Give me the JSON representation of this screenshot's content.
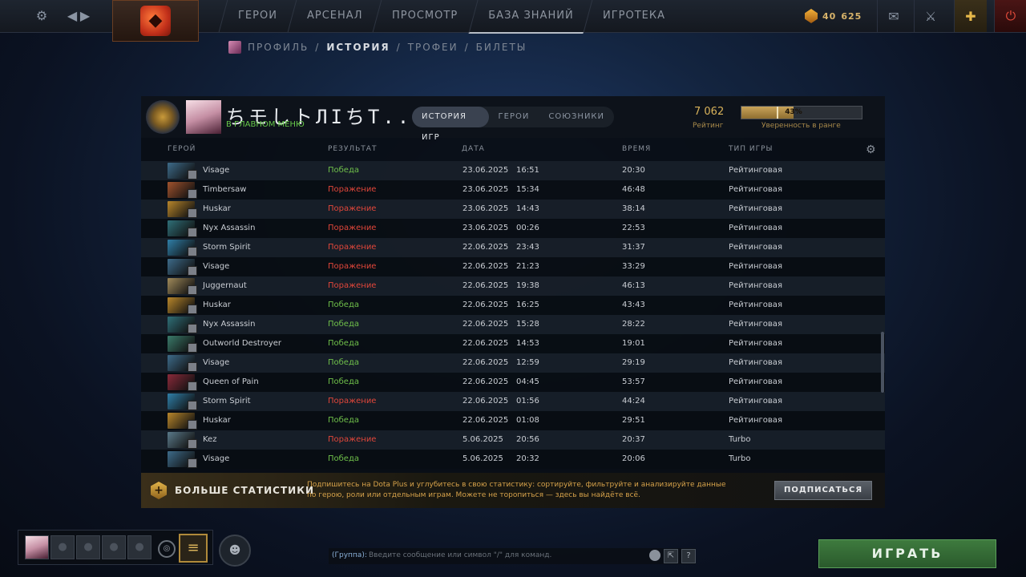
{
  "topbar": {
    "nav": [
      "ГЕРОИ",
      "АРСЕНАЛ",
      "ПРОСМОТР",
      "БАЗА ЗНАНИЙ",
      "ИГРОТЕКА"
    ],
    "currency_a": "40",
    "currency_b": "625",
    "icons": [
      "gear-icon",
      "back-arrow-icon",
      "forward-arrow-icon",
      "dota-logo-icon",
      "mail-icon",
      "armory-icon",
      "dota-plus-icon",
      "power-icon"
    ]
  },
  "subnav": {
    "profile": "ПРОФИЛЬ",
    "sep1": "/",
    "history": "ИСТОРИЯ",
    "sep2": "/",
    "trophies": "ТРОФЕИ",
    "sep3": "/",
    "tickets": "БИЛЕТЫ"
  },
  "player": {
    "name": "ちモしトЛIちT...",
    "status": "В ГЛАВНОМ МЕНЮ"
  },
  "tabs": [
    "ИСТОРИЯ ИГР",
    "ГЕРОИ",
    "СОЮЗНИКИ"
  ],
  "stats": {
    "rating_value": "7 062",
    "rating_label": "Рейтинг",
    "confidence_percent": 43,
    "confidence_text": "43%",
    "confidence_label": "Уверенность в ранге"
  },
  "table": {
    "headers": [
      "ГЕРОЙ",
      "РЕЗУЛЬТАТ",
      "ДАТА",
      "ВРЕМЯ",
      "ТИП ИГРЫ"
    ],
    "rows": [
      {
        "hero": "Visage",
        "result": "Победа",
        "win": true,
        "date": "23.06.2025",
        "time": "16:51",
        "duration": "20:30",
        "type": "Рейтинговая",
        "hero_color": "#3d6b8a"
      },
      {
        "hero": "Timbersaw",
        "result": "Поражение",
        "win": false,
        "date": "23.06.2025",
        "time": "15:34",
        "duration": "46:48",
        "type": "Рейтинговая",
        "hero_color": "#a0522d"
      },
      {
        "hero": "Huskar",
        "result": "Поражение",
        "win": false,
        "date": "23.06.2025",
        "time": "14:43",
        "duration": "38:14",
        "type": "Рейтинговая",
        "hero_color": "#b8862b"
      },
      {
        "hero": "Nyx Assassin",
        "result": "Поражение",
        "win": false,
        "date": "23.06.2025",
        "time": "00:26",
        "duration": "22:53",
        "type": "Рейтинговая",
        "hero_color": "#2f6f78"
      },
      {
        "hero": "Storm Spirit",
        "result": "Поражение",
        "win": false,
        "date": "22.06.2025",
        "time": "23:43",
        "duration": "31:37",
        "type": "Рейтинговая",
        "hero_color": "#2f7fa8"
      },
      {
        "hero": "Visage",
        "result": "Поражение",
        "win": false,
        "date": "22.06.2025",
        "time": "21:23",
        "duration": "33:29",
        "type": "Рейтинговая",
        "hero_color": "#3d6b8a"
      },
      {
        "hero": "Juggernaut",
        "result": "Поражение",
        "win": false,
        "date": "22.06.2025",
        "time": "19:38",
        "duration": "46:13",
        "type": "Рейтинговая",
        "hero_color": "#a08a5a"
      },
      {
        "hero": "Huskar",
        "result": "Победа",
        "win": true,
        "date": "22.06.2025",
        "time": "16:25",
        "duration": "43:43",
        "type": "Рейтинговая",
        "hero_color": "#b8862b"
      },
      {
        "hero": "Nyx Assassin",
        "result": "Победа",
        "win": true,
        "date": "22.06.2025",
        "time": "15:28",
        "duration": "28:22",
        "type": "Рейтинговая",
        "hero_color": "#2f6f78"
      },
      {
        "hero": "Outworld Destroyer",
        "result": "Победа",
        "win": true,
        "date": "22.06.2025",
        "time": "14:53",
        "duration": "19:01",
        "type": "Рейтинговая",
        "hero_color": "#3a7a6a"
      },
      {
        "hero": "Visage",
        "result": "Победа",
        "win": true,
        "date": "22.06.2025",
        "time": "12:59",
        "duration": "29:19",
        "type": "Рейтинговая",
        "hero_color": "#3d6b8a"
      },
      {
        "hero": "Queen of Pain",
        "result": "Победа",
        "win": true,
        "date": "22.06.2025",
        "time": "04:45",
        "duration": "53:57",
        "type": "Рейтинговая",
        "hero_color": "#8a2a3a"
      },
      {
        "hero": "Storm Spirit",
        "result": "Поражение",
        "win": false,
        "date": "22.06.2025",
        "time": "01:56",
        "duration": "44:24",
        "type": "Рейтинговая",
        "hero_color": "#2f7fa8"
      },
      {
        "hero": "Huskar",
        "result": "Победа",
        "win": true,
        "date": "22.06.2025",
        "time": "01:08",
        "duration": "29:51",
        "type": "Рейтинговая",
        "hero_color": "#b8862b"
      },
      {
        "hero": "Kez",
        "result": "Поражение",
        "win": false,
        "date": "5.06.2025",
        "time": "20:56",
        "duration": "20:37",
        "type": "Turbo",
        "hero_color": "#5a7a8a"
      },
      {
        "hero": "Visage",
        "result": "Победа",
        "win": true,
        "date": "5.06.2025",
        "time": "20:32",
        "duration": "20:06",
        "type": "Turbo",
        "hero_color": "#3d6b8a"
      }
    ]
  },
  "dota_plus": {
    "title": "БОЛЬШЕ СТАТИСТИКИ",
    "description": "Подпишитесь на Dota Plus и углубитесь в свою статистику: сортируйте, фильтруйте и анализируйте данные по герою, роли или отдельным играм. Можете не торопиться — здесь вы найдёте всё.",
    "button": "ПОДПИСАТЬСЯ"
  },
  "chat": {
    "channel": "(Группа):",
    "placeholder": "Введите сообщение или символ \"/\" для команд.",
    "help": "?"
  },
  "play_button": "ИГРАТЬ",
  "colors": {
    "win": "#6fbf4a",
    "loss": "#e0463a",
    "accent_gold": "#d8b25a",
    "play_green": "#3e7a3e"
  }
}
